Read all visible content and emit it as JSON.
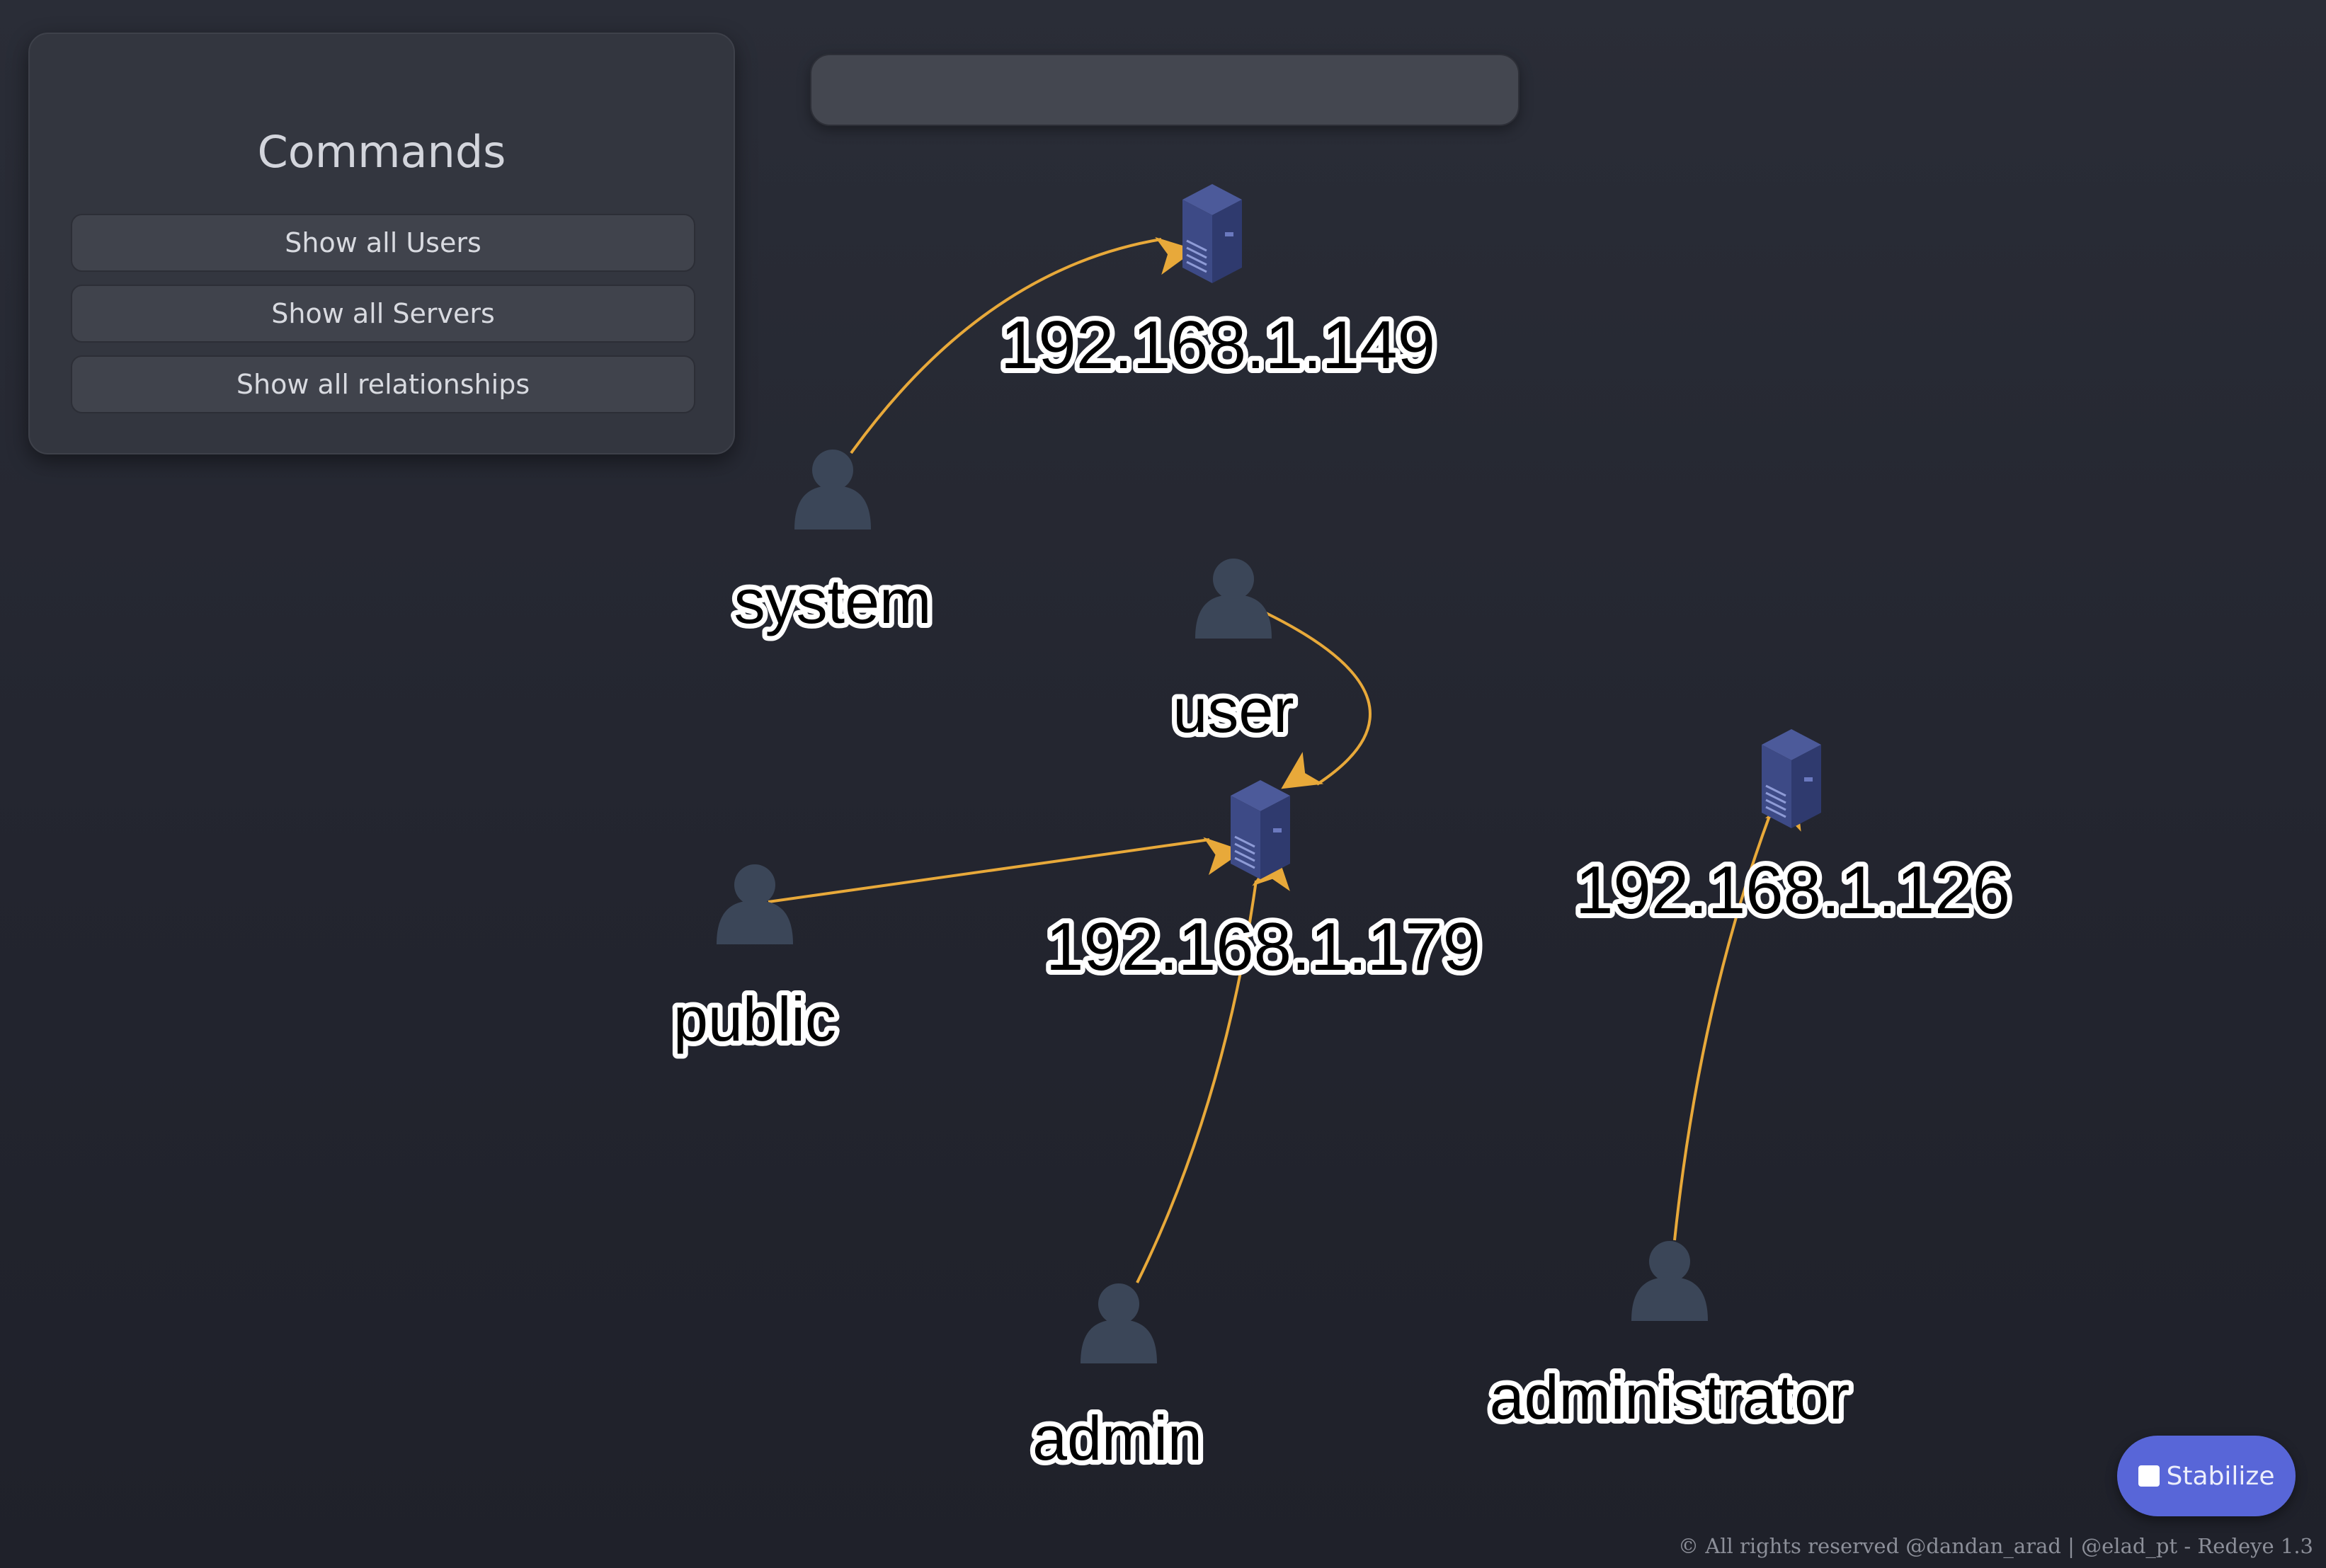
{
  "commands": {
    "title": "Commands",
    "buttons": [
      {
        "label": "Show all Users"
      },
      {
        "label": "Show all Servers"
      },
      {
        "label": "Show all relationships"
      }
    ]
  },
  "search": {
    "value": "",
    "placeholder": ""
  },
  "graph": {
    "edge_color": "#e8a93a",
    "user_icon_color": "#3b4658",
    "server_icon_color": "#3d4a86",
    "nodes": [
      {
        "id": "srv149",
        "type": "server",
        "label": "192.168.1.149"
      },
      {
        "id": "srv179",
        "type": "server",
        "label": "192.168.1.179"
      },
      {
        "id": "srv126",
        "type": "server",
        "label": "192.168.1.126"
      },
      {
        "id": "system",
        "type": "user",
        "label": "system"
      },
      {
        "id": "user",
        "type": "user",
        "label": "user"
      },
      {
        "id": "public",
        "type": "user",
        "label": "public"
      },
      {
        "id": "admin",
        "type": "user",
        "label": "admin"
      },
      {
        "id": "administrator",
        "type": "user",
        "label": "administrator"
      }
    ],
    "edges": [
      {
        "from": "system",
        "to": "srv149"
      },
      {
        "from": "user",
        "to": "srv179"
      },
      {
        "from": "public",
        "to": "srv179"
      },
      {
        "from": "admin",
        "to": "srv179"
      },
      {
        "from": "administrator",
        "to": "srv126"
      }
    ]
  },
  "stabilize": {
    "label": "Stabilize",
    "checked": false,
    "color": "#5866d8"
  },
  "footer": {
    "text": "© All rights reserved @dandan_arad | @elad_pt - Redeye 1.3"
  }
}
